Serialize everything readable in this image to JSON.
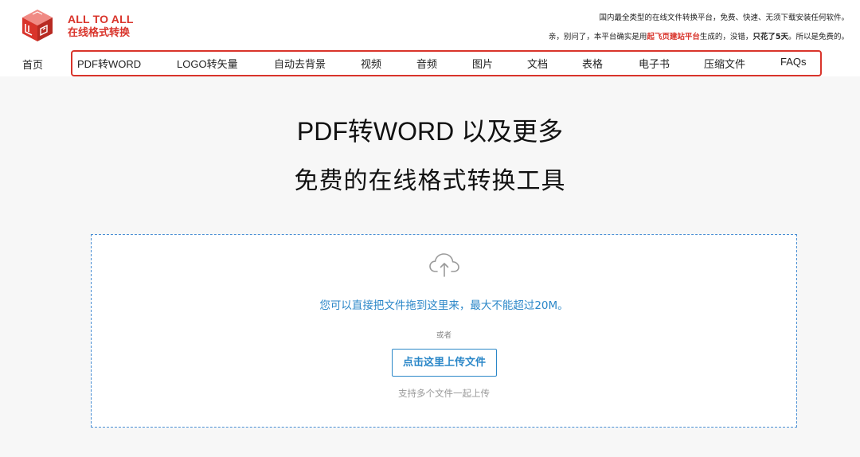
{
  "brand": {
    "line1": "ALL TO ALL",
    "line2": "在线格式转换",
    "logo_icon": "logo-cube-icon",
    "accent_color": "#d9342b"
  },
  "header_notice": {
    "line1": "国内最全类型的在线文件转换平台，免费、快速、无须下载安装任何软件。",
    "line2_a": "亲，别问了，本平台确实是用",
    "line2_highlight": "起飞页建站平台",
    "line2_b": "生成的，没错，",
    "line2_bold": "只花了5天",
    "line2_c": "。所以是免费的。"
  },
  "nav": {
    "home": "首页",
    "items": [
      "PDF转WORD",
      "LOGO转矢量",
      "自动去背景",
      "视频",
      "音频",
      "图片",
      "文档",
      "表格",
      "电子书",
      "压缩文件",
      "FAQs"
    ]
  },
  "hero": {
    "title": "PDF转WORD 以及更多",
    "subtitle": "免费的在线格式转换工具"
  },
  "upload": {
    "icon": "cloud-upload-icon",
    "drop_text": "您可以直接把文件拖到这里来，最大不能超过20M。",
    "or": "或者",
    "button_label": "点击这里上传文件",
    "multi_hint": "支持多个文件一起上传",
    "accent_color": "#2b87c8"
  }
}
